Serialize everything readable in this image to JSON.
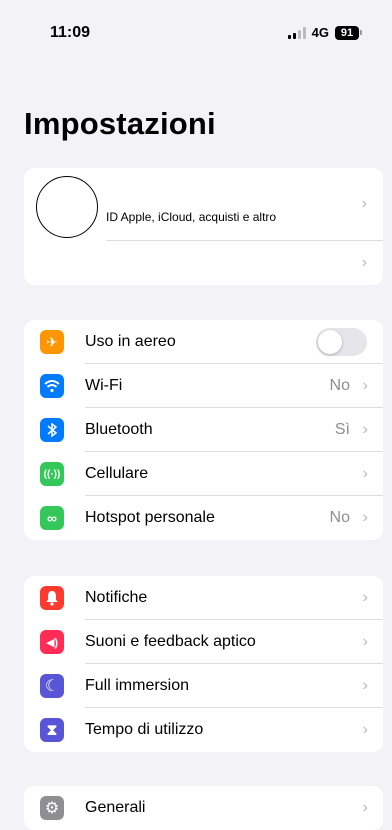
{
  "status_bar": {
    "time": "11:09",
    "network": "4G",
    "battery": "91"
  },
  "title": "Impostazioni",
  "profile": {
    "label": "ID Apple, iCloud, acquisti e altro"
  },
  "connectivity": [
    {
      "label": "Uso in aereo",
      "icon": "airplane-icon",
      "color": "#ff9500",
      "glyph": "✈",
      "toggle": false
    },
    {
      "label": "Wi-Fi",
      "icon": "wifi-icon",
      "color": "#007aff",
      "glyph": "≋",
      "value": "No"
    },
    {
      "label": "Bluetooth",
      "icon": "bluetooth-icon",
      "color": "#007aff",
      "glyph": "ᛒ",
      "value": "Sì"
    },
    {
      "label": "Cellulare",
      "icon": "antenna-icon",
      "color": "#34c759",
      "glyph": "((·))",
      "value": ""
    },
    {
      "label": "Hotspot personale",
      "icon": "hotspot-link-icon",
      "color": "#34c759",
      "glyph": "∞",
      "value": "No"
    }
  ],
  "notifications": [
    {
      "label": "Notifiche",
      "icon": "bell-icon",
      "color": "#ff3b30",
      "glyph": "🔔"
    },
    {
      "label": "Suoni e feedback aptico",
      "icon": "speaker-icon",
      "color": "#ff2d55",
      "glyph": "◀)"
    },
    {
      "label": "Full immersion",
      "icon": "moon-icon",
      "color": "#5856d6",
      "glyph": "☾"
    },
    {
      "label": "Tempo di utilizzo",
      "icon": "hourglass-icon",
      "color": "#5856d6",
      "glyph": "⧗"
    }
  ],
  "general": [
    {
      "label": "Generali",
      "icon": "gear-icon",
      "color": "#8e8e93",
      "glyph": "⚙"
    }
  ],
  "chevron": "›"
}
